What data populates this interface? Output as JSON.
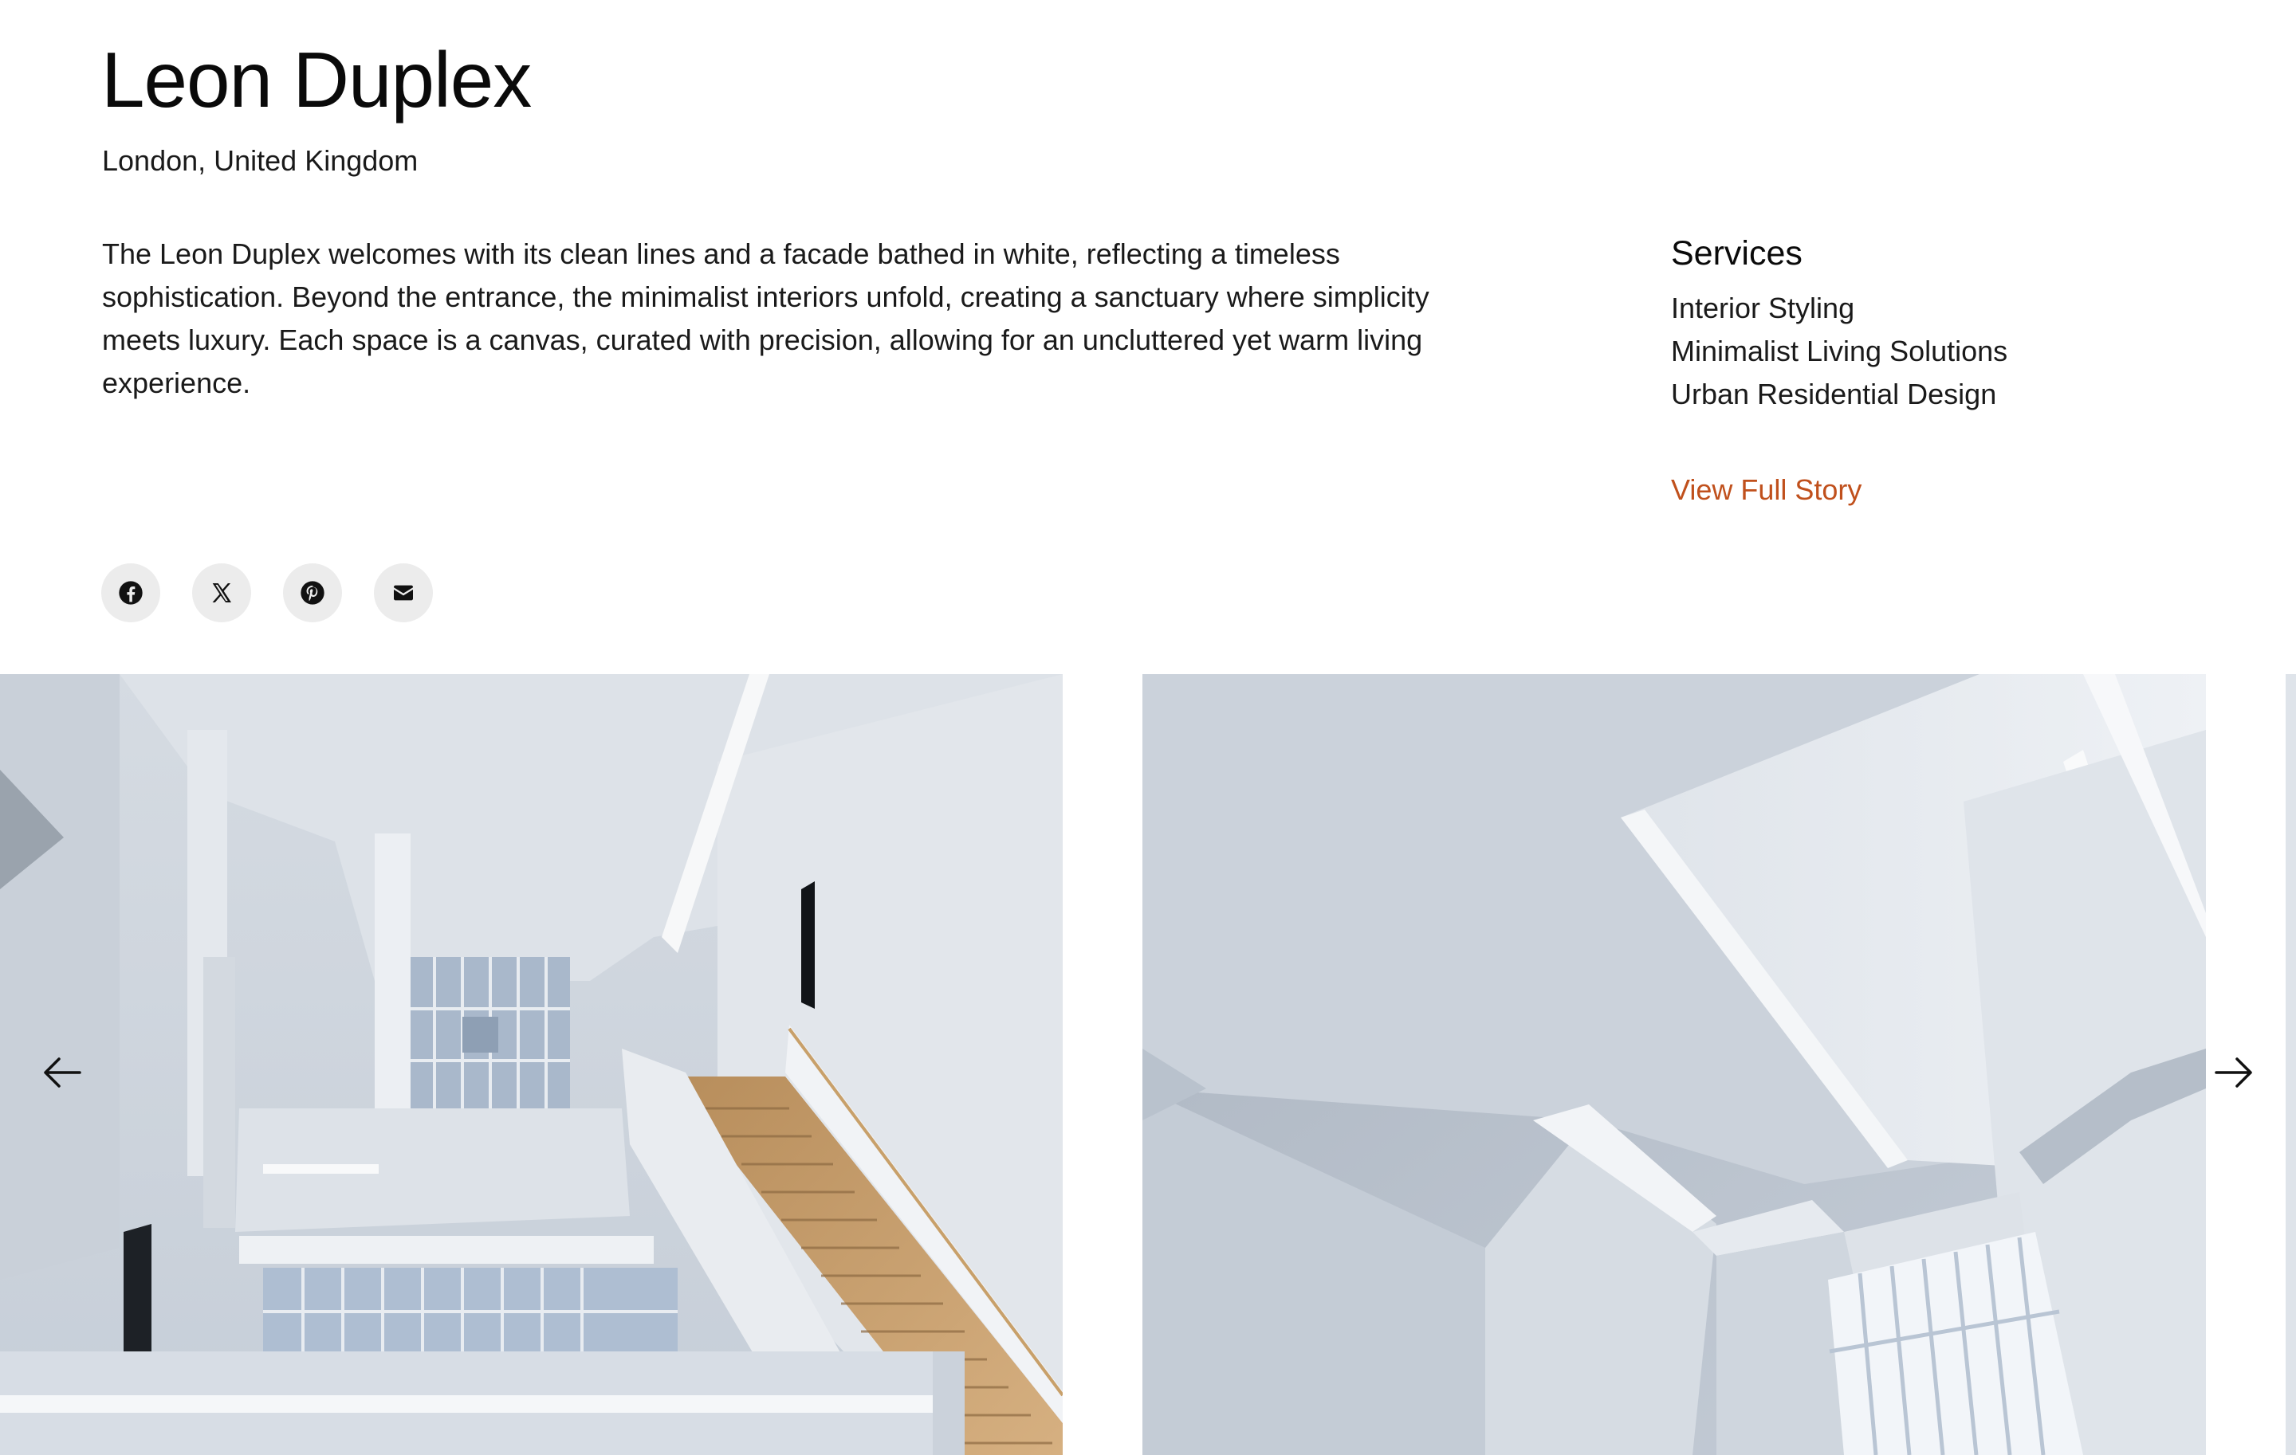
{
  "project": {
    "title": "Leon Duplex",
    "location": "London, United Kingdom",
    "description": "The Leon Duplex welcomes with its clean lines and a facade bathed in white, reflecting a timeless sophistication. Beyond the entrance, the minimalist interiors unfold, creating a sanctuary where simplicity meets luxury. Each space is a canvas, curated with precision, allowing for an uncluttered yet warm living experience."
  },
  "services": {
    "heading": "Services",
    "items": [
      "Interior Styling",
      "Minimalist Living Solutions",
      "Urban Residential Design"
    ]
  },
  "cta": {
    "label": "View Full Story",
    "color": "#c0501c"
  },
  "share": {
    "icons": [
      "facebook-icon",
      "x-icon",
      "pinterest-icon",
      "email-icon"
    ]
  },
  "gallery": {
    "prev_icon": "arrow-left-icon",
    "next_icon": "arrow-right-icon",
    "slides": [
      {
        "depicts": "white minimalist atrium with wooden staircase"
      },
      {
        "depicts": "white sloped ceiling with light strips and tall window"
      }
    ]
  }
}
